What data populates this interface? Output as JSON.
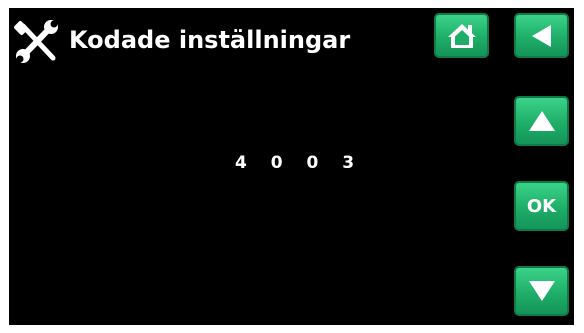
{
  "header": {
    "title": "Kodade inställningar",
    "title_icon": "wrench-screwdriver-icon"
  },
  "main": {
    "code_value": "4 0 0 3"
  },
  "buttons": {
    "home_icon": "home-icon",
    "back_icon": "back-arrow-icon",
    "up_icon": "up-arrow-icon",
    "ok_label": "OK",
    "down_icon": "down-arrow-icon"
  },
  "colors": {
    "screen_background": "#000000",
    "button_green": "#1fae68",
    "text": "#ffffff"
  }
}
